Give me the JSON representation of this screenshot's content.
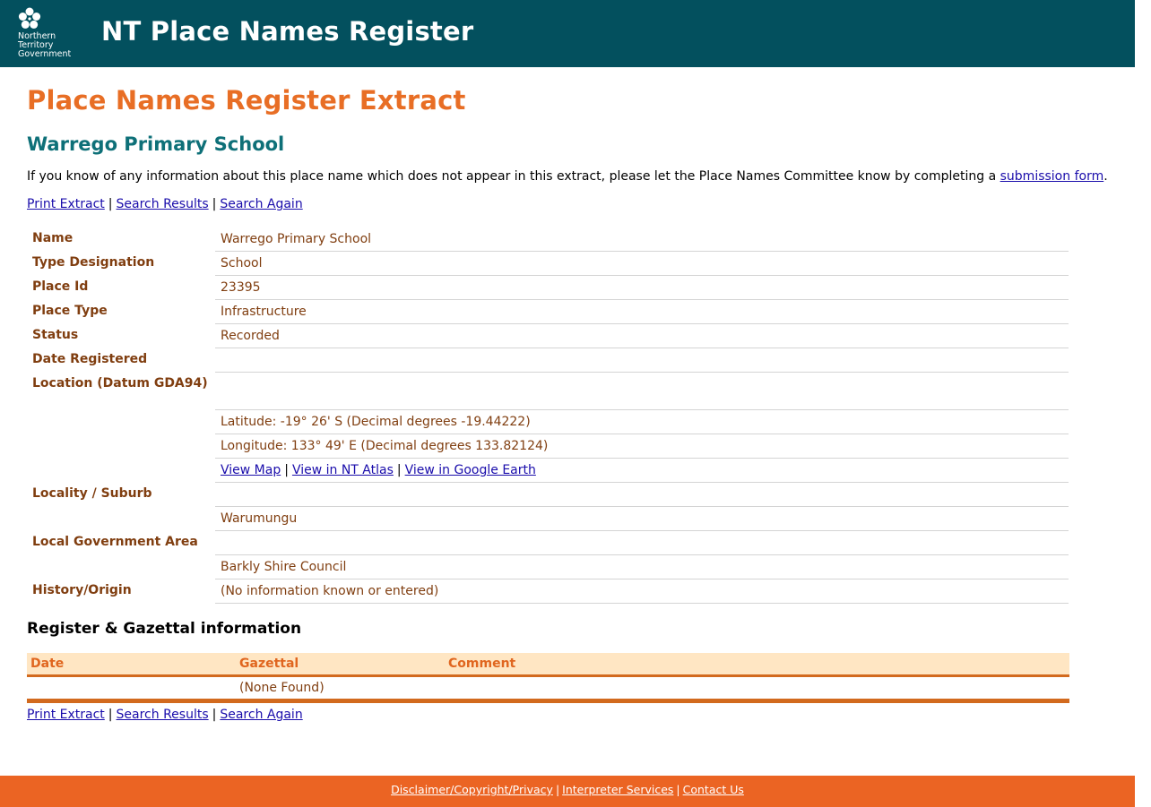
{
  "header": {
    "logo_lines": [
      "Northern",
      "Territory",
      "Government"
    ],
    "title": "NT Place Names Register"
  },
  "page_title": "Place Names Register Extract",
  "place_name_heading": "Warrego Primary School",
  "intro": {
    "text": "If you know of any information about this place name which does not appear in this extract, please let the Place Names Committee know by completing a ",
    "link_text": "submission form",
    "suffix": "."
  },
  "nav_links": [
    "Print Extract",
    "Search Results",
    "Search Again"
  ],
  "nav_separator": "|",
  "details": [
    {
      "label": "Name",
      "value": "Warrego Primary School"
    },
    {
      "label": "Type Designation",
      "value": "School"
    },
    {
      "label": "Place Id",
      "value": "23395"
    },
    {
      "label": "Place Type",
      "value": "Infrastructure"
    },
    {
      "label": "Status",
      "value": "Recorded"
    },
    {
      "label": "Date Registered",
      "value": ""
    },
    {
      "label": "Location (Datum GDA94)",
      "value": ""
    },
    {
      "label": "",
      "value": "Latitude: -19° 26' S (Decimal degrees -19.44222)"
    },
    {
      "label": "",
      "value": "Longitude: 133° 49' E (Decimal degrees 133.82124)"
    },
    {
      "label": "Locality / Suburb",
      "value": ""
    },
    {
      "label": "",
      "value": "Warumungu"
    },
    {
      "label": "Local Government Area",
      "value": ""
    },
    {
      "label": "",
      "value": "Barkly Shire Council"
    },
    {
      "label": "History/Origin",
      "value": "(No information known or entered)"
    }
  ],
  "map_links": [
    "View Map",
    "View in NT Atlas",
    "View in Google Earth"
  ],
  "register_heading": "Register & Gazettal information",
  "register_table": {
    "columns": [
      "Date",
      "Gazettal",
      "Comment"
    ],
    "rows": [
      [
        "",
        "(None Found)",
        ""
      ]
    ]
  },
  "footer_links": [
    "Disclaimer/Copyright/Privacy",
    "Interpreter Services",
    "Contact Us"
  ],
  "colors": {
    "header_bg": "#03505e",
    "page_title": "#e86e25",
    "place_heading": "#0e7078",
    "detail_text": "#803e10",
    "footer_bg": "#eb6423"
  }
}
